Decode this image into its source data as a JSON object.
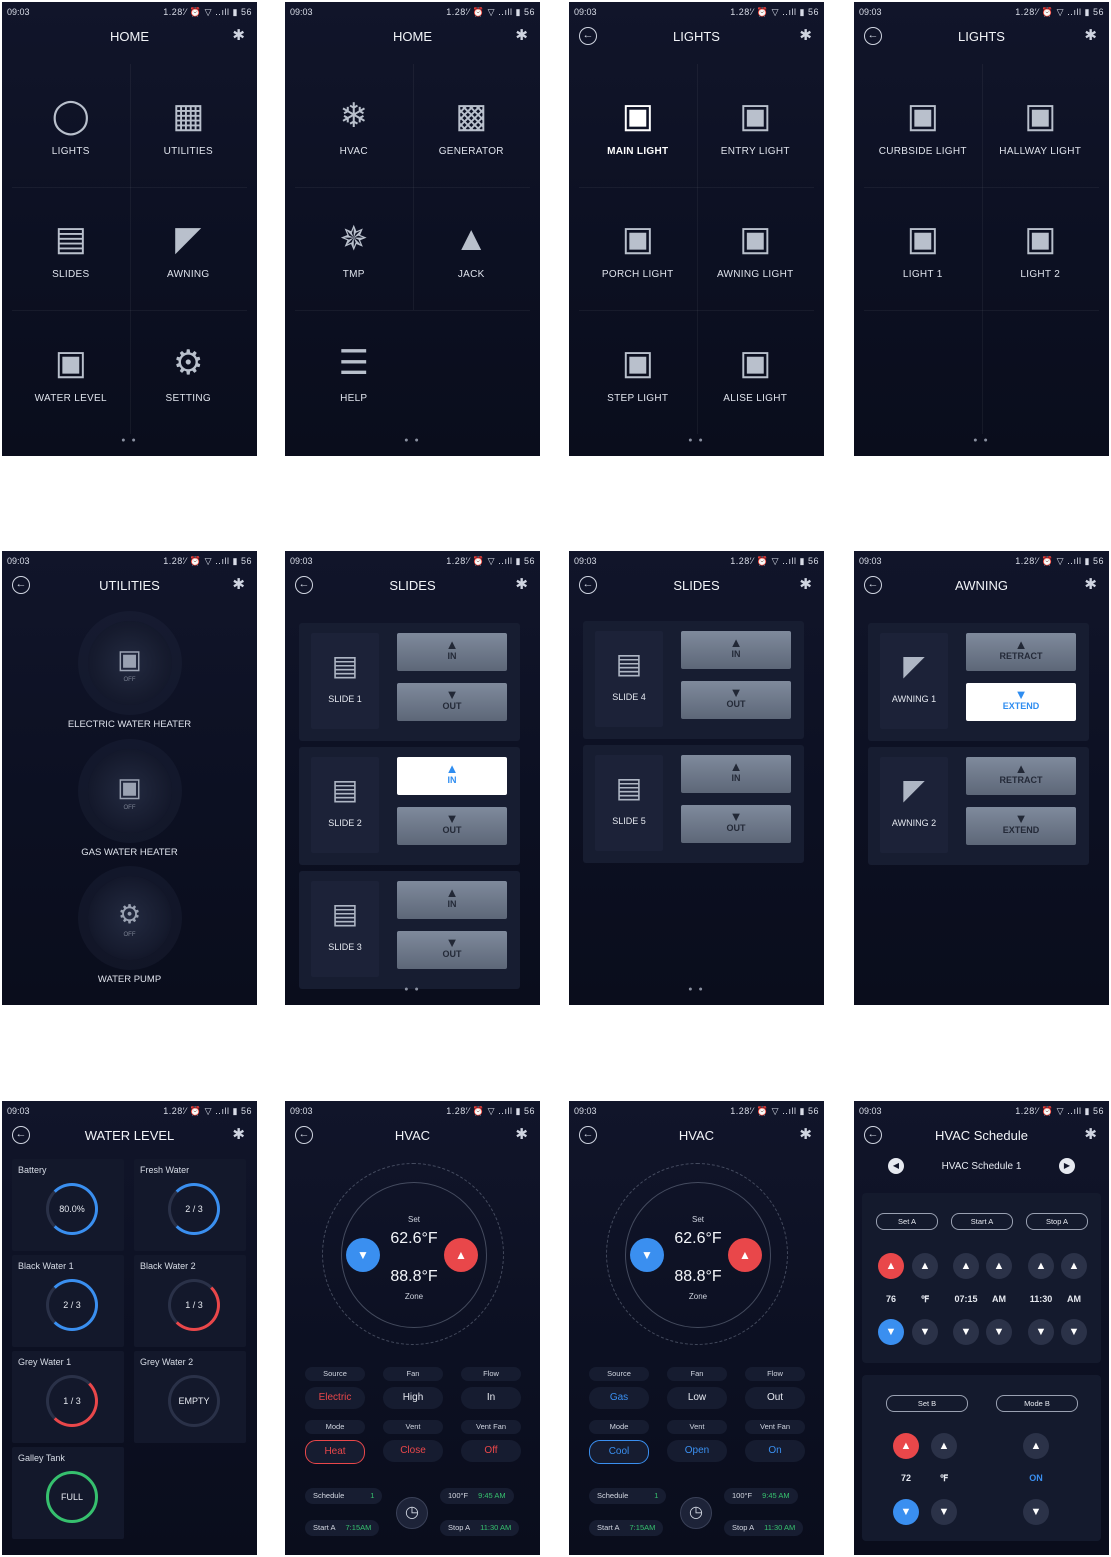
{
  "status": {
    "time": "09:03",
    "right": "1.28′⁄ ⏰ ▽ ‥ıll ▮ 56"
  },
  "glyph": {
    "back": "←",
    "bt": "✱",
    "dots": "● ●"
  },
  "home1": {
    "title": "HOME",
    "tiles": [
      {
        "label": "LIGHTS",
        "icon": "◯"
      },
      {
        "label": "UTILITIES",
        "icon": "▦"
      },
      {
        "label": "SLIDES",
        "icon": "▤"
      },
      {
        "label": "AWNING",
        "icon": "◤"
      },
      {
        "label": "WATER LEVEL",
        "icon": "▣"
      },
      {
        "label": "SETTING",
        "icon": "⚙"
      }
    ]
  },
  "home2": {
    "title": "HOME",
    "tiles": [
      {
        "label": "HVAC",
        "icon": "❄"
      },
      {
        "label": "GENERATOR",
        "icon": "▩"
      },
      {
        "label": "TMP",
        "icon": "✵"
      },
      {
        "label": "JACK",
        "icon": "▲"
      },
      {
        "label": "HELP",
        "icon": "☰"
      }
    ]
  },
  "lights1": {
    "title": "LIGHTS",
    "tiles": [
      {
        "label": "MAIN LIGHT",
        "icon": "▣"
      },
      {
        "label": "ENTRY LIGHT",
        "icon": "▣"
      },
      {
        "label": "PORCH LIGHT",
        "icon": "▣"
      },
      {
        "label": "AWNING LIGHT",
        "icon": "▣"
      },
      {
        "label": "STEP LIGHT",
        "icon": "▣"
      },
      {
        "label": "ALISE LIGHT",
        "icon": "▣"
      }
    ]
  },
  "lights2": {
    "title": "LIGHTS",
    "tiles": [
      {
        "label": "CURBSIDE LIGHT",
        "icon": "▣"
      },
      {
        "label": "HALLWAY LIGHT",
        "icon": "▣"
      },
      {
        "label": "LIGHT 1",
        "icon": "▣"
      },
      {
        "label": "LIGHT 2",
        "icon": "▣"
      }
    ]
  },
  "utilities": {
    "title": "UTILITIES",
    "off": "OFF",
    "items": [
      {
        "label": "ELECTRIC WATER HEATER",
        "icon": "▣"
      },
      {
        "label": "GAS WATER HEATER",
        "icon": "▣"
      },
      {
        "label": "WATER PUMP",
        "icon": "⚙"
      }
    ]
  },
  "arrows": {
    "up": "▲",
    "down": "▼"
  },
  "slides1": {
    "title": "SLIDES",
    "in": "IN",
    "out": "OUT",
    "items": [
      {
        "label": "SLIDE 1",
        "icon": "▤"
      },
      {
        "label": "SLIDE 2",
        "icon": "▤"
      },
      {
        "label": "SLIDE 3",
        "icon": "▤"
      }
    ]
  },
  "slides2": {
    "title": "SLIDES",
    "in": "IN",
    "out": "OUT",
    "items": [
      {
        "label": "SLIDE 4",
        "icon": "▤"
      },
      {
        "label": "SLIDE 5",
        "icon": "▤"
      }
    ]
  },
  "awning": {
    "title": "AWNING",
    "retract": "RETRACT",
    "extend": "EXTEND",
    "items": [
      {
        "label": "AWNING 1",
        "icon": "◤"
      },
      {
        "label": "AWNING 2",
        "icon": "◤"
      }
    ]
  },
  "water": {
    "title": "WATER LEVEL",
    "tanks": [
      {
        "name": "Battery",
        "value": "80.0%",
        "fill": 0.8
      },
      {
        "name": "Fresh Water",
        "value": "2 / 3",
        "fill": 0.67
      },
      {
        "name": "Black Water 1",
        "value": "2 / 3",
        "fill": 0.67
      },
      {
        "name": "Black Water 2",
        "value": "1 / 3",
        "fill": 0.33
      },
      {
        "name": "Grey Water 1",
        "value": "1 / 3",
        "fill": 0.33
      },
      {
        "name": "Grey Water 2",
        "value": "EMPTY",
        "fill": 0
      },
      {
        "name": "Galley Tank",
        "value": "FULL",
        "fill": 1
      }
    ]
  },
  "hvac1": {
    "title": "HVAC",
    "set": "Set",
    "t1": "62.6°F",
    "t2": "88.8°F",
    "zone": "Zone",
    "source_k": "Source",
    "source_v": "Electric",
    "fan_k": "Fan",
    "fan_v": "High",
    "flow_k": "Flow",
    "flow_v": "In",
    "mode_k": "Mode",
    "mode_v": "Heat",
    "vent_k": "Vent",
    "vent_v": "Close",
    "ventfan_k": "Vent Fan",
    "ventfan_v": "Off",
    "sched": "Schedule",
    "sched_n": "1",
    "temp": "100°F",
    "time1": "9:45 AM",
    "starta": "Start A",
    "starta_t": "7:15AM",
    "stopa": "Stop A",
    "stopa_t": "11:30 AM"
  },
  "hvac2": {
    "title": "HVAC",
    "set": "Set",
    "t1": "62.6°F",
    "t2": "88.8°F",
    "zone": "Zone",
    "source_k": "Source",
    "source_v": "Gas",
    "fan_k": "Fan",
    "fan_v": "Low",
    "flow_k": "Flow",
    "flow_v": "Out",
    "mode_k": "Mode",
    "mode_v": "Cool",
    "vent_k": "Vent",
    "vent_v": "Open",
    "ventfan_k": "Vent Fan",
    "ventfan_v": "On",
    "sched": "Schedule",
    "sched_n": "1",
    "temp": "100°F",
    "time1": "9:45 AM",
    "starta": "Start A",
    "starta_t": "7:15AM",
    "stopa": "Stop A",
    "stopa_t": "11:30 AM"
  },
  "schedule": {
    "title": "HVAC  Schedule",
    "name": "HVAC  Schedule 1",
    "seta": "Set A",
    "starta": "Start A",
    "stopa": "Stop A",
    "v76": "76",
    "f": "℉",
    "t715": "07:15",
    "am": "AM",
    "t1130": "11:30",
    "setb": "Set B",
    "modeb": "Mode B",
    "v72": "72",
    "on": "ON",
    "prev": "◀",
    "next": "▶"
  },
  "colors": {
    "accent_blue": "#3a8ff0",
    "accent_red": "#e9474a",
    "green": "#36c06e"
  }
}
